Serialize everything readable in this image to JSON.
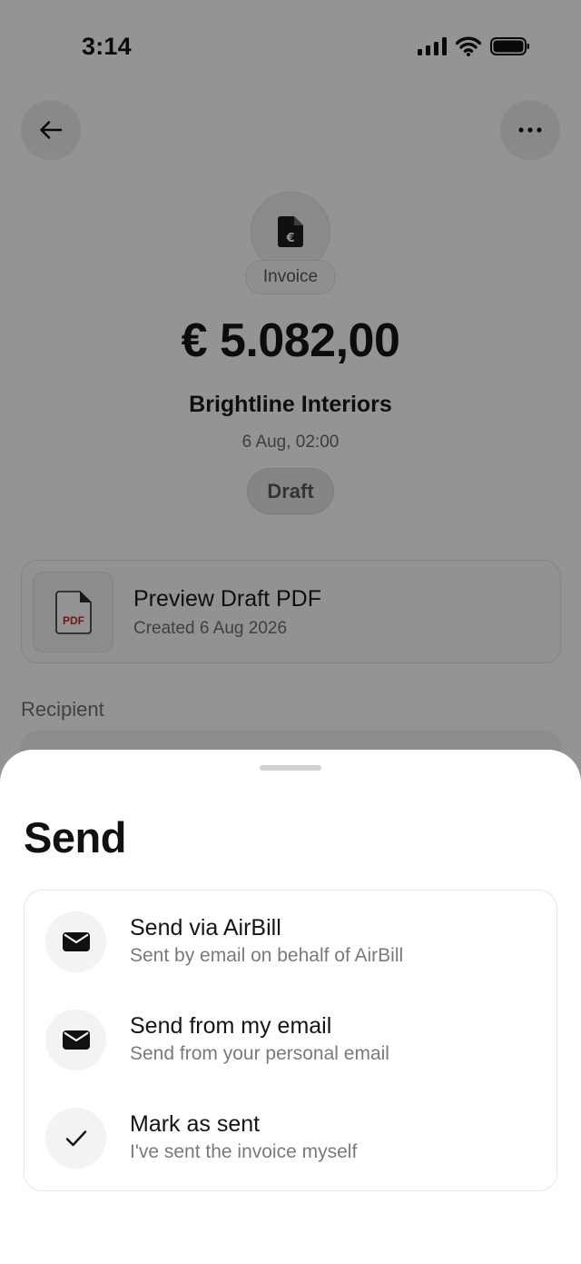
{
  "status_bar": {
    "time": "3:14",
    "icons": [
      "cellular-signal-icon",
      "wifi-icon",
      "battery-icon"
    ]
  },
  "header": {
    "back_icon": "arrow-left-icon",
    "more_icon": "more-horizontal-icon"
  },
  "invoice": {
    "icon": "euro-document-icon",
    "type_label": "Invoice",
    "amount": "€ 5.082,00",
    "client": "Brightline Interiors",
    "date": "6 Aug, 02:00",
    "status": "Draft"
  },
  "pdf_preview": {
    "icon_text": "PDF",
    "title": "Preview Draft PDF",
    "subtitle": "Created 6 Aug 2026"
  },
  "recipient": {
    "label": "Recipient"
  },
  "send_sheet": {
    "title": "Send",
    "options": [
      {
        "icon": "envelope-icon",
        "title": "Send via AirBill",
        "subtitle": "Sent by email on behalf of AirBill"
      },
      {
        "icon": "envelope-icon",
        "title": "Send from my email",
        "subtitle": "Send from your personal email"
      },
      {
        "icon": "checkmark-icon",
        "title": "Mark as sent",
        "subtitle": "I've sent the invoice myself"
      }
    ]
  },
  "colors": {
    "overlay": "#000000",
    "pdf_accent": "#c62828",
    "text_primary": "#141414",
    "text_secondary": "#7a7a7a"
  }
}
